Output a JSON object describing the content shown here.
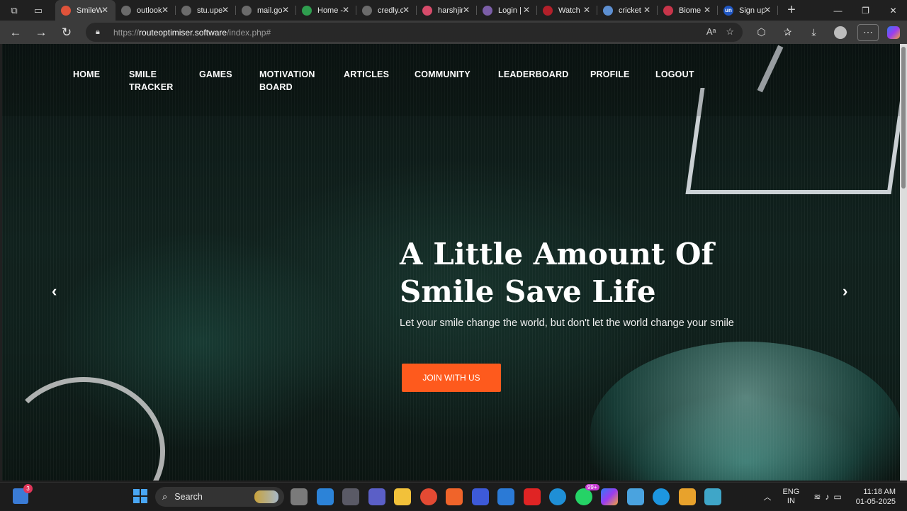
{
  "browser": {
    "tabs": [
      {
        "title": "SmileW",
        "fav_color": "#e0533a",
        "active": true
      },
      {
        "title": "outlook",
        "fav_color": "#6b6b6b"
      },
      {
        "title": "stu.upe",
        "fav_color": "#6b6b6b"
      },
      {
        "title": "mail.go",
        "fav_color": "#6b6b6b"
      },
      {
        "title": "Home -",
        "fav_color": "#2f9e4f"
      },
      {
        "title": "credly.c",
        "fav_color": "#6b6b6b"
      },
      {
        "title": "harshjin",
        "fav_color": "#d64b6a"
      },
      {
        "title": "Login |",
        "fav_color": "#7b5ea7"
      },
      {
        "title": "Watch",
        "fav_color": "#b3202a"
      },
      {
        "title": "cricket",
        "fav_color": "#5d8fd1"
      },
      {
        "title": "Biome",
        "fav_color": "#c7354a"
      },
      {
        "title": "Sign up",
        "fav_color": "#1f56c2",
        "fav_text": "un"
      }
    ],
    "url_prefix": "https://",
    "url_host": "routeoptimiser.software",
    "url_path": "/index.php#"
  },
  "site": {
    "nav": [
      {
        "label": "HOME"
      },
      {
        "label": "SMILE TRACKER"
      },
      {
        "label": "GAMES"
      },
      {
        "label": "MOTIVATION BOARD"
      },
      {
        "label": "ARTICLES"
      },
      {
        "label": "COMMUNITY"
      },
      {
        "label": "LEADERBOARD"
      },
      {
        "label": "PROFILE"
      },
      {
        "label": "LOGOUT"
      }
    ],
    "hero": {
      "title": "A Little Amount Of Smile Save Life",
      "subtitle": "Let your smile change the world, but don't let the world change your smile",
      "cta": "JOIN WITH US"
    },
    "accent": "#fe5a1d"
  },
  "taskbar": {
    "widget_badge": "3",
    "search_label": "Search",
    "whatsapp_badge": "99+",
    "lang_top": "ENG",
    "lang_bottom": "IN",
    "time": "11:18 AM",
    "date": "01-05-2025"
  }
}
